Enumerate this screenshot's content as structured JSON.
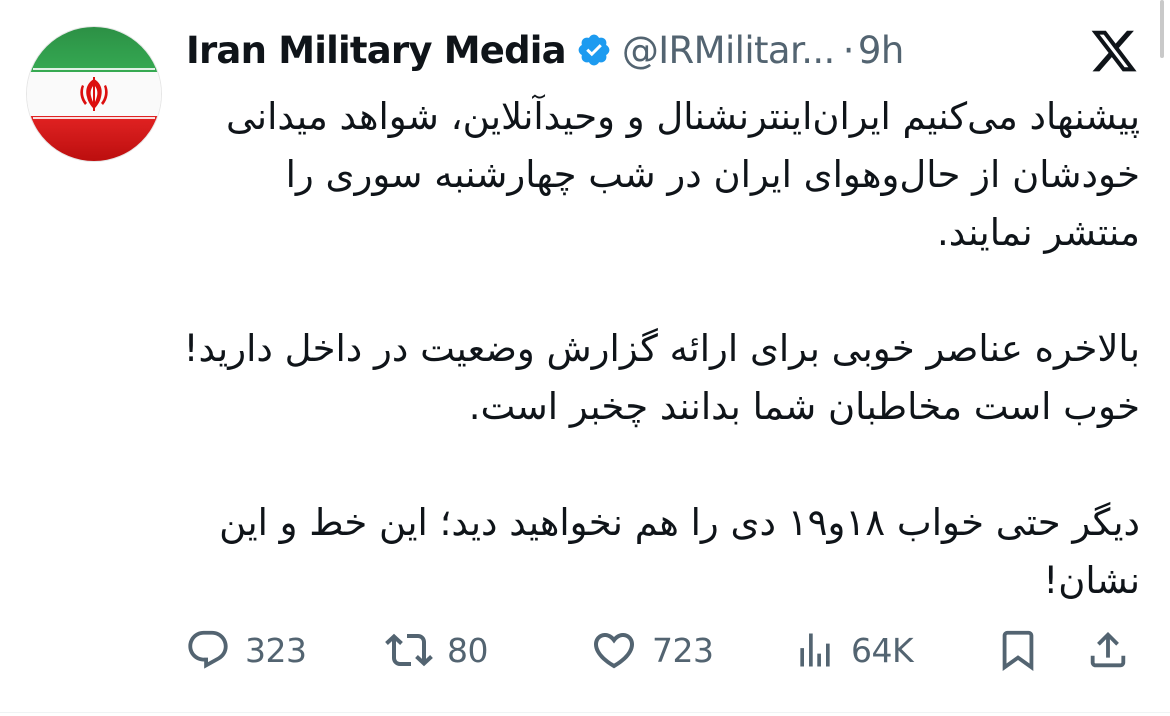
{
  "author": {
    "name": "Iran Military Media",
    "handle": "@IRMilitar...",
    "separator": "·",
    "time": "9h",
    "verified": true,
    "avatar_icon": "iran-flag-avatar"
  },
  "platform_logo": "x-logo-icon",
  "tweet": {
    "paragraphs": [
      "پیشنهاد می‌کنیم ایران‌اینترنشنال و وحیدآنلاین، شواهد میدانی خودشان از حال‌وهوای ایران در شب چهارشنبه سوری را منتشر نمایند.",
      "بالاخره عناصر خوبی برای ارائه گزارش وضعیت در داخل دارید! خوب است مخاطبان شما بدانند چخبر است.",
      "دیگر حتی خواب ۱۸و۱۹ دی را هم نخواهید دید؛ این خط و این نشان!"
    ]
  },
  "actions": {
    "replies": "323",
    "reposts": "80",
    "likes": "723",
    "views": "64K"
  },
  "colors": {
    "text": "#0f1419",
    "muted": "#536471",
    "verified": "#1d9bf0",
    "flag_green": "#239f40",
    "flag_red": "#da0000",
    "emblem_red": "#da0000"
  }
}
